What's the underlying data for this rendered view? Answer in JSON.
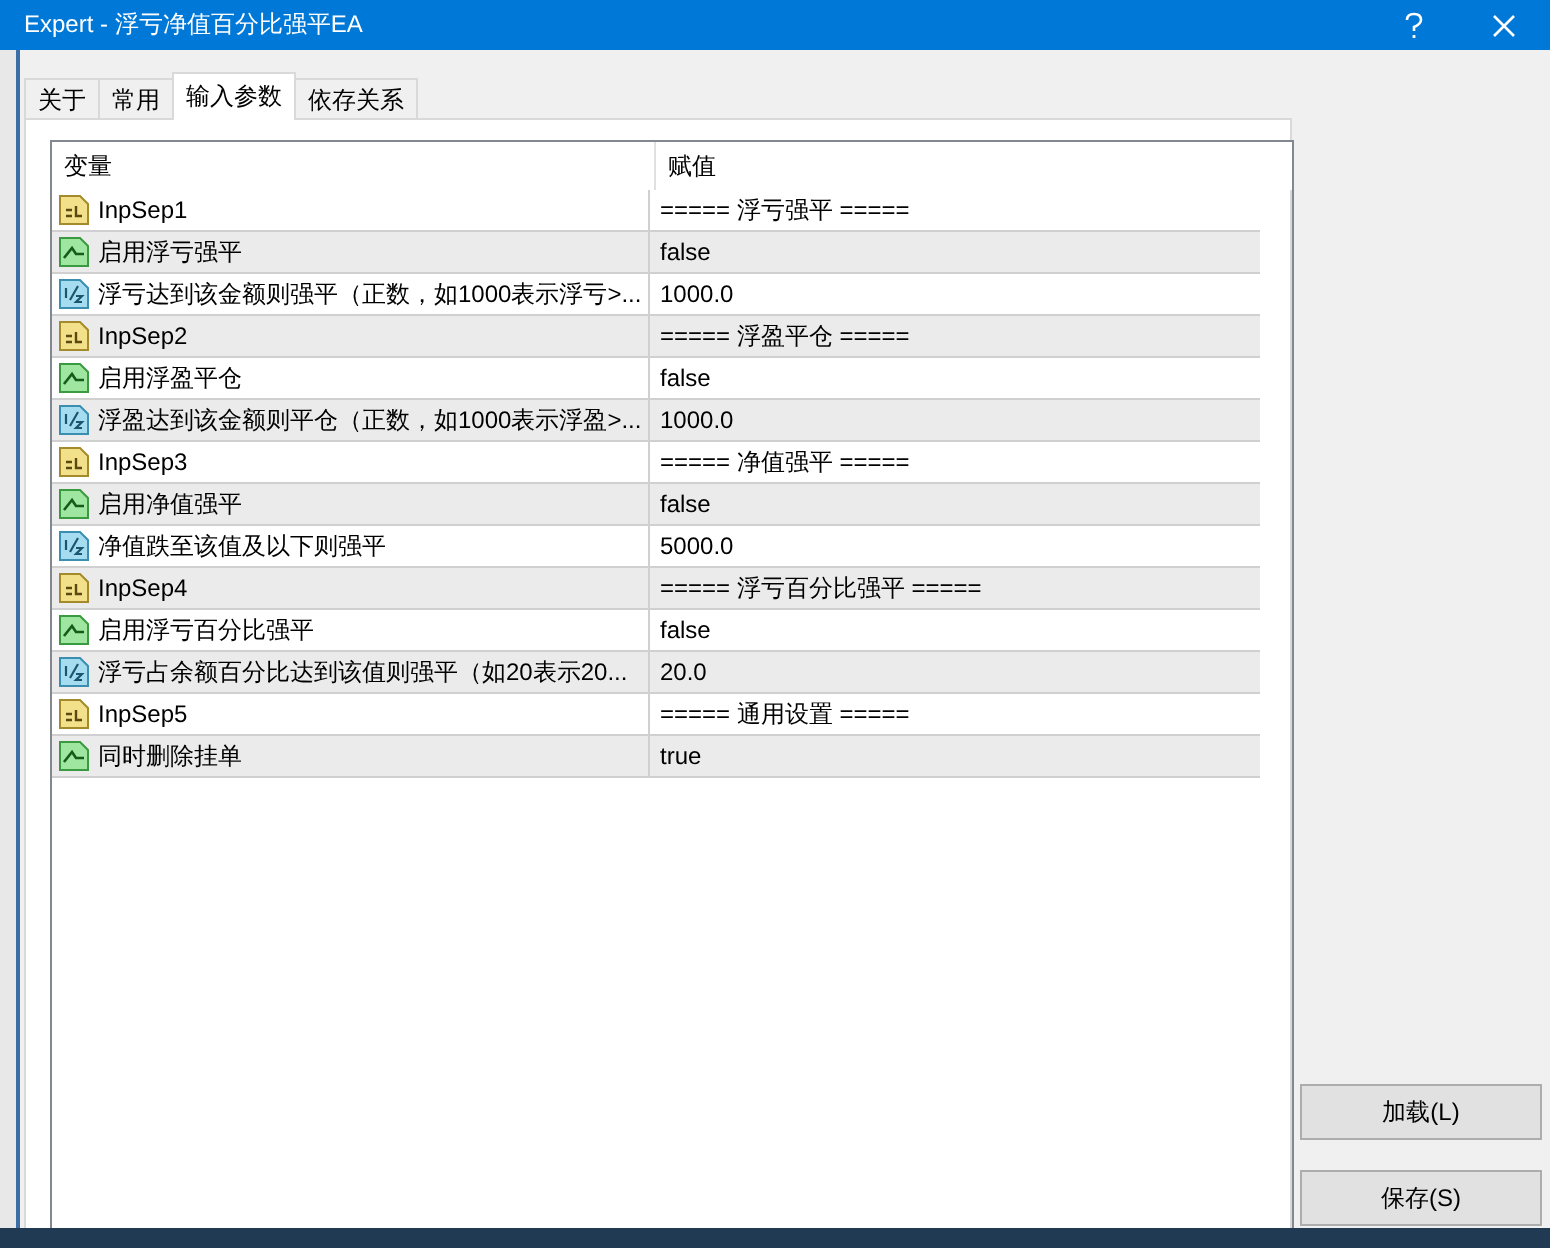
{
  "window": {
    "title": "Expert - 浮亏净值百分比强平EA"
  },
  "tabs": [
    {
      "label": "关于",
      "selected": false
    },
    {
      "label": "常用",
      "selected": false
    },
    {
      "label": "输入参数",
      "selected": true
    },
    {
      "label": "依存关系",
      "selected": false
    }
  ],
  "table": {
    "columns": [
      "变量",
      "赋值"
    ],
    "rows": [
      {
        "kind": "string",
        "name": "InpSep1",
        "value": "===== 浮亏强平 ====="
      },
      {
        "kind": "bool",
        "name": "启用浮亏强平",
        "value": "false"
      },
      {
        "kind": "double",
        "name": "浮亏达到该金额则强平（正数，如1000表示浮亏>...",
        "value": "1000.0"
      },
      {
        "kind": "string",
        "name": "InpSep2",
        "value": "===== 浮盈平仓 ====="
      },
      {
        "kind": "bool",
        "name": "启用浮盈平仓",
        "value": "false"
      },
      {
        "kind": "double",
        "name": "浮盈达到该金额则平仓（正数，如1000表示浮盈>...",
        "value": "1000.0"
      },
      {
        "kind": "string",
        "name": "InpSep3",
        "value": "===== 净值强平 ====="
      },
      {
        "kind": "bool",
        "name": "启用净值强平",
        "value": "false"
      },
      {
        "kind": "double",
        "name": "净值跌至该值及以下则强平",
        "value": "5000.0"
      },
      {
        "kind": "string",
        "name": "InpSep4",
        "value": "===== 浮亏百分比强平 ====="
      },
      {
        "kind": "bool",
        "name": "启用浮亏百分比强平",
        "value": "false"
      },
      {
        "kind": "double",
        "name": "浮亏占余额百分比达到该值则强平（如20表示20...",
        "value": "20.0"
      },
      {
        "kind": "string",
        "name": "InpSep5",
        "value": "===== 通用设置 ====="
      },
      {
        "kind": "bool",
        "name": "同时删除挂单",
        "value": "true"
      }
    ]
  },
  "buttons": [
    "加载(L)",
    "保存(S)"
  ]
}
